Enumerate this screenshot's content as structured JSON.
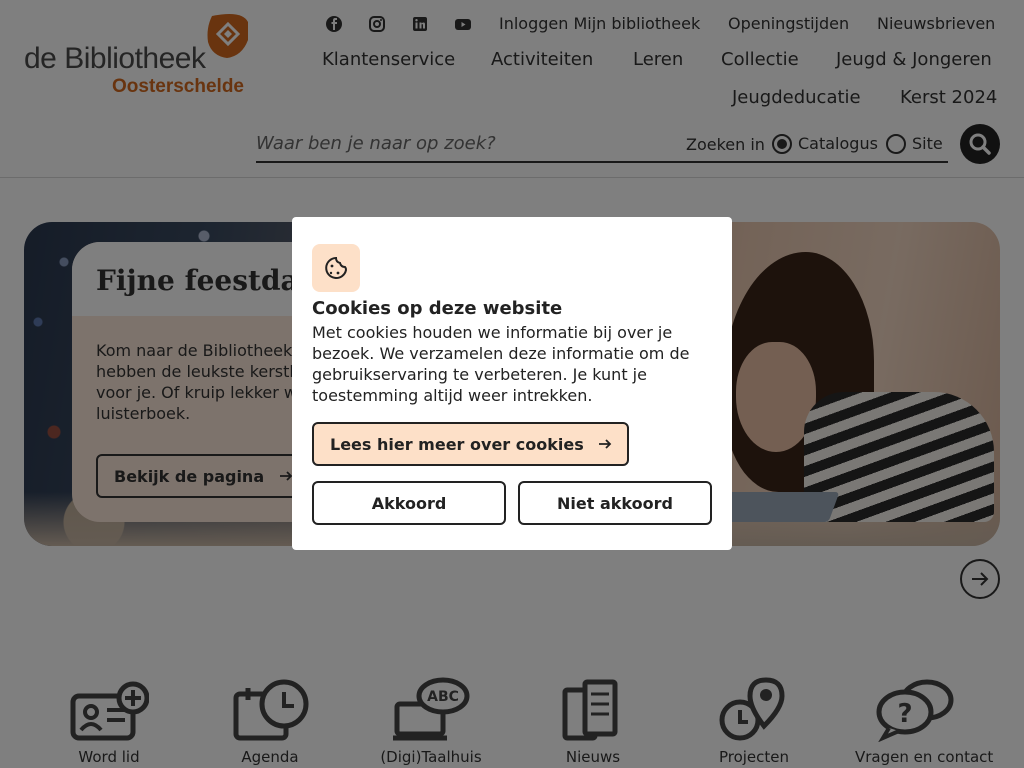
{
  "logo": {
    "line1": "de Bibliotheek",
    "line2": "Oosterschelde"
  },
  "social": [
    "facebook-icon",
    "instagram-icon",
    "linkedin-icon",
    "youtube-icon"
  ],
  "top_links": [
    "Inloggen Mijn bibliotheek",
    "Openingstijden",
    "Nieuwsbrieven"
  ],
  "nav": [
    "Klantenservice",
    "Activiteiten",
    "Leren",
    "Collectie",
    "Jeugd & Jongeren",
    "Jeugdeducatie",
    "Kerst 2024"
  ],
  "search": {
    "placeholder": "Waar ben je naar op zoek?",
    "scope_label": "Zoeken in",
    "options": [
      "Catalogus",
      "Site"
    ],
    "selected": "Catalogus"
  },
  "hero": {
    "title": "Fijne feestdag",
    "text": "Kom naar de Bibliotheek en ontdek het! Wij hebben de leukste kerstboeken en kerstfilms voor je. Of kruip lekker weg met een e-book of luisterboek.",
    "button": "Bekijk de pagina"
  },
  "tiles": [
    "Word lid",
    "Agenda",
    "(Digi)Taalhuis",
    "Nieuws",
    "Projecten",
    "Vragen en contact"
  ],
  "cookie": {
    "title": "Cookies op deze website",
    "text": "Met cookies houden we informatie bij over je bezoek. We verzamelen deze informatie om de gebruikservaring te verbeteren. Je kunt je toestemming altijd weer intrekken.",
    "more": "Lees hier meer over cookies",
    "accept": "Akkoord",
    "decline": "Niet akkoord"
  },
  "colors": {
    "brand_orange": "#d2691e",
    "cookie_accent": "#fde0c8",
    "dark": "#222222"
  }
}
